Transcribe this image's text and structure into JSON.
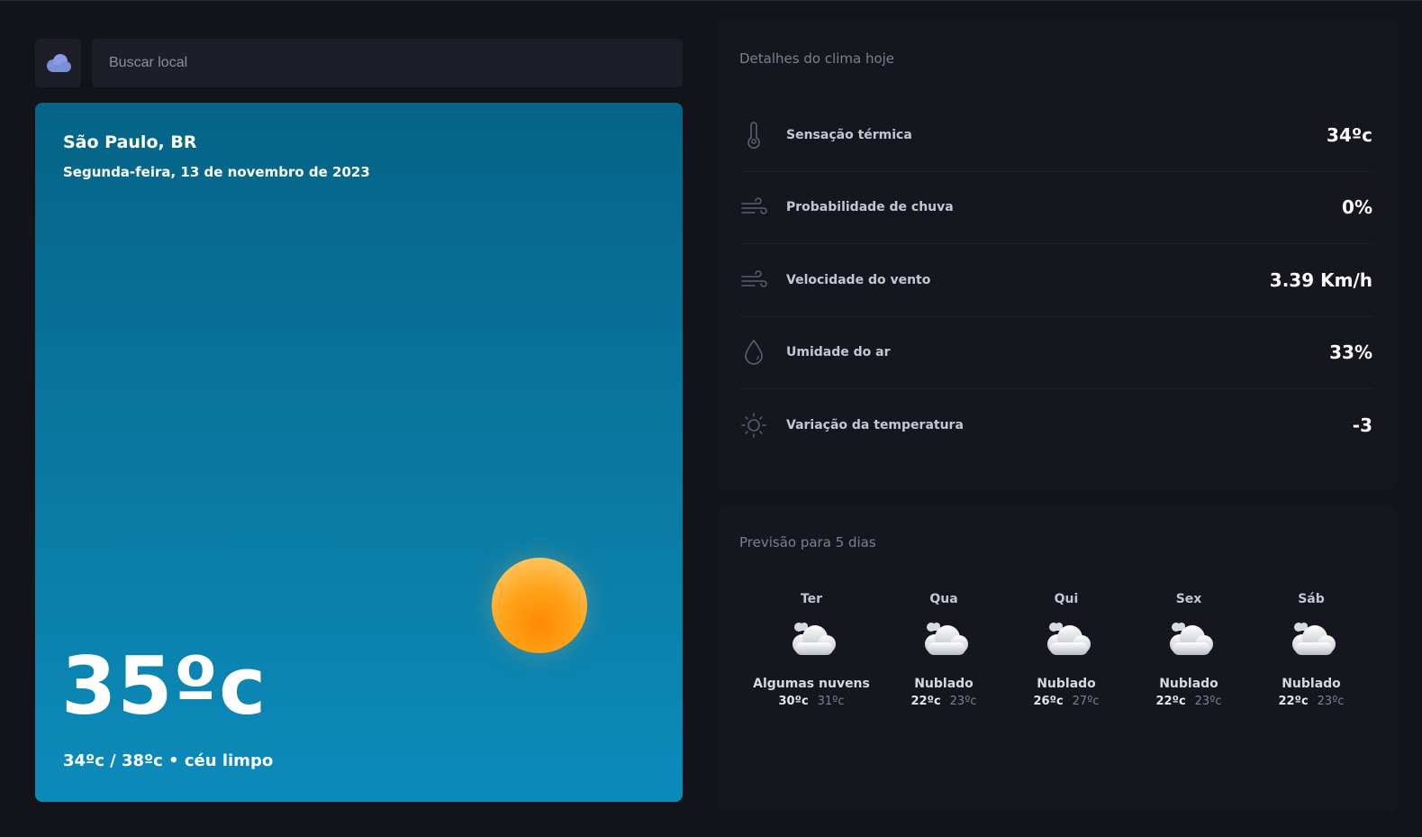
{
  "search": {
    "placeholder": "Buscar local"
  },
  "hero": {
    "city": "São Paulo, BR",
    "date": "Segunda-feira, 13 de novembro de 2023",
    "temperature": "35ºc",
    "summary": "34ºc / 38ºc • céu limpo"
  },
  "details": {
    "title": "Detalhes do clima hoje",
    "rows": [
      {
        "icon": "thermometer-icon",
        "label": "Sensação térmica",
        "value": "34ºc"
      },
      {
        "icon": "wind-icon",
        "label": "Probabilidade de chuva",
        "value": "0%"
      },
      {
        "icon": "wind-icon",
        "label": "Velocidade do vento",
        "value": "3.39 Km/h"
      },
      {
        "icon": "drop-icon",
        "label": "Umidade do ar",
        "value": "33%"
      },
      {
        "icon": "sun-icon",
        "label": "Variação da temperatura",
        "value": "-3"
      }
    ]
  },
  "forecast": {
    "title": "Previsão para 5 dias",
    "days": [
      {
        "name": "Ter",
        "icon": "partly-cloudy-icon",
        "desc": "Algumas nuvens",
        "min": "30ºc",
        "max": "31ºc"
      },
      {
        "name": "Qua",
        "icon": "cloudy-icon",
        "desc": "Nublado",
        "min": "22ºc",
        "max": "23ºc"
      },
      {
        "name": "Qui",
        "icon": "cloudy-icon",
        "desc": "Nublado",
        "min": "26ºc",
        "max": "27ºc"
      },
      {
        "name": "Sex",
        "icon": "cloudy-icon",
        "desc": "Nublado",
        "min": "22ºc",
        "max": "23ºc"
      },
      {
        "name": "Sáb",
        "icon": "cloudy-icon",
        "desc": "Nublado",
        "min": "22ºc",
        "max": "23ºc"
      }
    ]
  },
  "colors": {
    "background": "#13141a",
    "panel": "#16171e",
    "accent": "#7b8fd8",
    "sun": "#ff9a0a"
  }
}
